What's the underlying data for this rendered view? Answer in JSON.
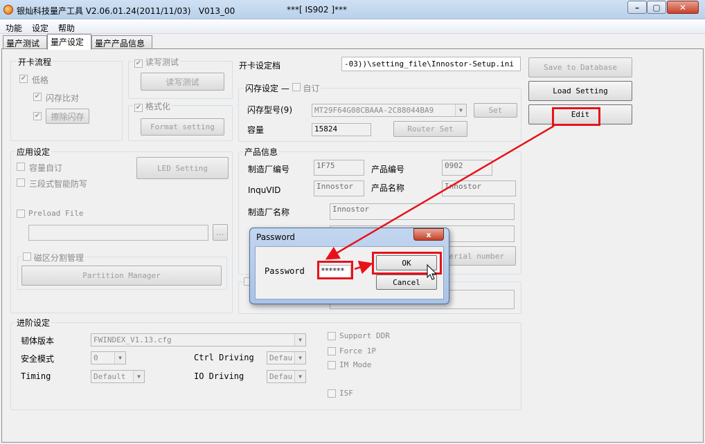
{
  "window": {
    "title": "银灿科技量产工具 V2.06.01.24(2011/11/03)   V013_00",
    "subtitle": "***[ IS902 ]***",
    "min": "–",
    "max": "▢",
    "close": "✕"
  },
  "menu": [
    "功能",
    "设定",
    "帮助"
  ],
  "tabs": [
    "量产测试",
    "量产设定",
    "量产产品信息"
  ],
  "open_flow": {
    "legend": "开卡流程",
    "low_format": "低格",
    "flash_compare": "闪存比对",
    "erase_flash": "擦除闪存"
  },
  "rw_test": {
    "legend": "读写测试",
    "button": "读写测试"
  },
  "format": {
    "legend": "格式化",
    "button": "Format setting"
  },
  "setting_file": {
    "label": "开卡设定档",
    "value": "-03))\\setting_file\\Innostor-Setup.ini"
  },
  "flash_setting": {
    "legend": "闪存设定",
    "custom": "自订",
    "model_label": "闪存型号(9)",
    "model_value": "MT29F64G08CBAAA-2C88044BA9",
    "set_button": "Set",
    "capacity_label": "容量",
    "capacity_value": "15824",
    "router_button": "Router Set"
  },
  "right_buttons": {
    "save_db": "Save to Database",
    "load": "Load Setting",
    "edit": "Edit"
  },
  "app_setting": {
    "legend": "应用设定",
    "capacity_custom": "容量自订",
    "three_stage": "三段式智能防写",
    "led_button": "LED Setting",
    "preload": "Preload File",
    "browse": "...",
    "partition_legend": "磁区分割管理",
    "partition_button": "Partition Manager"
  },
  "product_info": {
    "legend": "产品信息",
    "vendor_no_label": "制造厂编号",
    "vendor_no_value": "1F75",
    "product_no_label": "产品编号",
    "product_no_value": "0902",
    "inquvid_label": "InquVID",
    "inquvid_value": "Innostor",
    "product_name_label": "产品名称",
    "product_name_value": "Innostor",
    "vendor_name_label": "制造厂名称",
    "vendor_name_value": "Innostor",
    "serial_button_tail": "erial number"
  },
  "advanced": {
    "legend": "进阶设定",
    "firmware_label": "韧体版本",
    "firmware_value": "FWINDEX_V1.13.cfg",
    "safe_mode_label": "安全模式",
    "safe_mode_value": "0",
    "timing_label": "Timing",
    "timing_value": "Default",
    "ctrl_driving_label": "Ctrl Driving",
    "ctrl_driving_value": "Defau",
    "io_driving_label": "IO Driving",
    "io_driving_value": "Defau",
    "support_ddr": "Support DDR",
    "force_1p": "Force 1P",
    "im_mode": "IM Mode",
    "isf": "ISF"
  },
  "password_dialog": {
    "title": "Password",
    "close": "x",
    "label": "Password",
    "value": "******",
    "ok": "OK",
    "cancel": "Cancel"
  },
  "colors": {
    "highlight": "#e8111a"
  }
}
